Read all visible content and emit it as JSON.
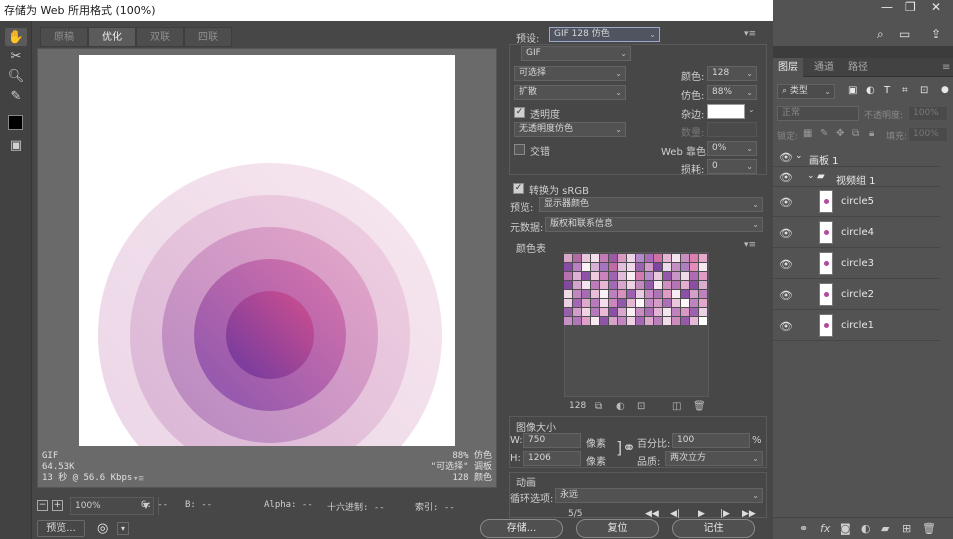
{
  "dialog": {
    "title": "存储为 Web 所用格式 (100%)",
    "tabs": [
      "原稿",
      "优化",
      "双联",
      "四联"
    ],
    "active_tab": "优化"
  },
  "preview_info": {
    "format": "GIF",
    "size": "64.53K",
    "time": "13 秒 @ 56.6 Kbps",
    "dither": "88% 仿色",
    "palette": "\"可选择\" 调板",
    "colors": "128 颜色"
  },
  "status": {
    "zoom": "100%",
    "g": "G: --",
    "b": "B: --",
    "alpha": "Alpha: --",
    "hex": "十六进制: --",
    "index": "索引: --"
  },
  "buttons": {
    "preview": "预览...",
    "save": "存储...",
    "reset": "复位",
    "remember": "记住"
  },
  "settings": {
    "preset_label": "预设:",
    "preset": "GIF 128 仿色",
    "format": "GIF",
    "reduction": "可选择",
    "dither_algo": "扩散",
    "colors_label": "颜色:",
    "colors": "128",
    "dither_label": "仿色:",
    "dither": "88%",
    "transparency": "透明度",
    "matte_label": "杂边:",
    "trans_dither": "无透明度仿色",
    "amount_label": "数量:",
    "interlaced": "交错",
    "web_snap_label": "Web 靠色:",
    "web_snap": "0%",
    "lossy_label": "损耗:",
    "lossy": "0",
    "convert_srgb": "转换为 sRGB",
    "preview_label": "预览:",
    "preview_value": "显示器颜色",
    "metadata_label": "元数据:",
    "metadata_value": "版权和联系信息",
    "color_table_title": "颜色表",
    "color_count": "128",
    "image_size_title": "图像大小",
    "w_label": "W:",
    "w": "750",
    "h_label": "H:",
    "h": "1206",
    "px": "像素",
    "percent_label": "百分比:",
    "percent": "100",
    "percent_unit": "%",
    "quality_label": "品质:",
    "quality": "两次立方",
    "animation_title": "动画",
    "loop_label": "循环选项:",
    "loop": "永远",
    "frame": "5/5"
  },
  "color_table": {
    "swatches": [
      "#d9a6c8",
      "#b06aa4",
      "#e7c6dd",
      "#f3e0ec",
      "#c47cb6",
      "#9c5aa6",
      "#d99ac2",
      "#ecd3e6",
      "#b48acb",
      "#a86bb8",
      "#cf70a8",
      "#e5b3d3",
      "#f5e4ef",
      "#c98fc0",
      "#dd7fae",
      "#e8a9cc",
      "#874aa6",
      "#b981c4",
      "#fbf1f7",
      "#d6b2d6",
      "#a575bd",
      "#c16aa5",
      "#e1c0dd",
      "#f0d6e8",
      "#9b62ae",
      "#d49bc9",
      "#7e46a0",
      "#ecd9ea",
      "#c58ec5",
      "#ae7ec0",
      "#e58cb8",
      "#f7e8f1",
      "#b76fae",
      "#dcb1d5",
      "#8e53a8",
      "#efcbe0",
      "#cb84bb",
      "#a063b1",
      "#e2bcd9",
      "#f9edf4",
      "#d17bb1",
      "#b98bc8",
      "#e9c8de",
      "#9457a9",
      "#c796c6",
      "#f2dbe9",
      "#ad6cb4",
      "#df9dc6",
      "#84489f",
      "#d5a4cd",
      "#f4e2ee",
      "#bd7bba",
      "#e5b8d4",
      "#a26bb6",
      "#dba6cc",
      "#eed1e5",
      "#c48abf",
      "#975bad",
      "#f6e6f0",
      "#cf8fc0",
      "#b574b4",
      "#e3aecf",
      "#8a4ea5",
      "#d9aecf",
      "#f1d8e8",
      "#c287c0",
      "#a869b5",
      "#e7bfd8",
      "#fcf3f8",
      "#ba80bf",
      "#d691bf",
      "#9e60b0",
      "#ebcbe1",
      "#c98ac1",
      "#af73b8",
      "#e09cc5",
      "#f8ebf3",
      "#8c50a6",
      "#d3a0ca",
      "#c07fbd",
      "#edcfe4",
      "#a465b3",
      "#dda9cd",
      "#b77bbc",
      "#f3dfec",
      "#cc86bd",
      "#9259aa",
      "#e6b7d5",
      "#fefafc",
      "#c18cc4",
      "#d89ac7",
      "#ab70b7",
      "#eac6dd",
      "#fdf7fa",
      "#bd84c0",
      "#e2a8cc",
      "#9a5eae",
      "#d29ec9",
      "#f0d4e6",
      "#b479ba",
      "#e8bad6",
      "#8b4fa6",
      "#d7a7ce",
      "#fbeff5",
      "#c88bc3",
      "#a96cb5",
      "#e4b2d2",
      "#f5e5ef",
      "#bf82be",
      "#d998c4",
      "#9f62b1",
      "#ecd0e4",
      "#c690c6",
      "#b076b9",
      "#e19fc7",
      "#f7e9f2",
      "#8f54a8",
      "#d5a3cc",
      "#c386c1",
      "#eecfe4",
      "#a668b4",
      "#dfa9cd",
      "#ba7ebd",
      "#f2dcea",
      "#ce89bf",
      "#955bab",
      "#e7b9d6",
      "#ffffff"
    ]
  },
  "layers_panel": {
    "tabs": [
      "图层",
      "通道",
      "路径"
    ],
    "filter_kind": "类型",
    "blend_mode": "正常",
    "opacity_label": "不透明度:",
    "opacity": "100%",
    "lock_label": "锁定:",
    "fill_label": "填充:",
    "fill": "100%",
    "artboard": "画板 1",
    "group": "视频组 1",
    "layers": [
      "circle5",
      "circle4",
      "circle3",
      "circle2",
      "circle1"
    ]
  }
}
